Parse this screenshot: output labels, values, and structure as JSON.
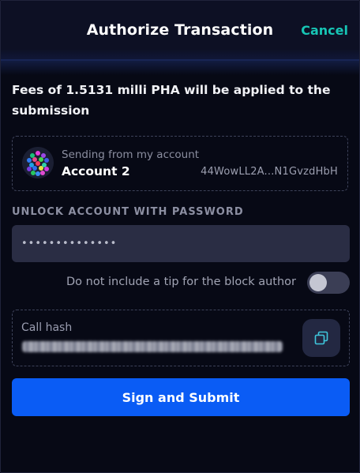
{
  "header": {
    "title": "Authorize Transaction",
    "cancel_label": "Cancel"
  },
  "fees_text": "Fees of 1.5131 milli PHA will be applied to the submission",
  "account": {
    "subtitle": "Sending from my account",
    "name": "Account 2",
    "address": "44WowLL2A...N1GvzdHbH"
  },
  "password": {
    "label": "UNLOCK ACCOUNT WITH PASSWORD",
    "value": "••••••••••••••"
  },
  "tip": {
    "label": "Do not include a tip for the block author",
    "enabled": false
  },
  "call_hash": {
    "label": "Call hash"
  },
  "submit_label": "Sign and Submit",
  "colors": {
    "accent": "#17c5b5",
    "primary_button": "#0a5cf5",
    "background": "#070915"
  }
}
